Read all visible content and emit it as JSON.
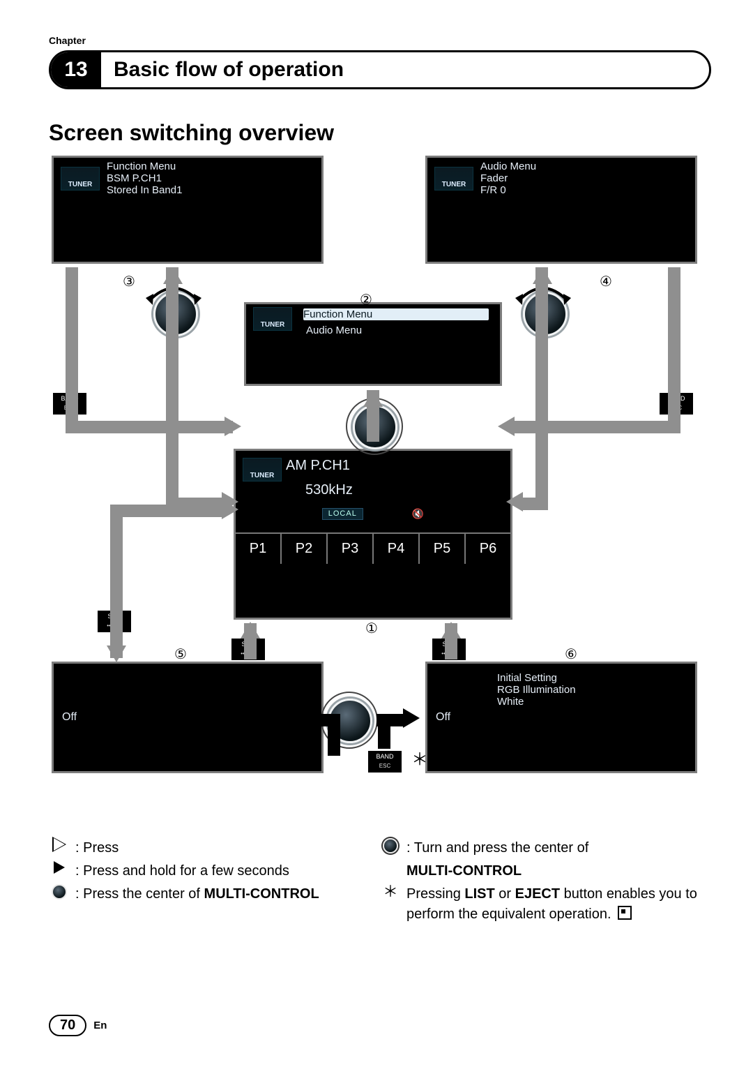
{
  "header": {
    "chapter_label": "Chapter",
    "number": "13",
    "title": "Basic flow of operation"
  },
  "h2": "Screen switching overview",
  "screens": {
    "top_left": {
      "badge": "TUNER",
      "lines": [
        "Function Menu",
        "BSM P.CH1",
        "Stored In Band1"
      ]
    },
    "top_right": {
      "badge": "TUNER",
      "lines": [
        "Audio Menu",
        "Fader",
        "F/R 0"
      ]
    },
    "middle_menu": {
      "badge": "TUNER",
      "highlight": "Function Menu",
      "line2": "Audio Menu"
    },
    "main": {
      "badge": "TUNER",
      "line1": "AM P.CH1",
      "freq": "530kHz",
      "local_tag": "LOCAL",
      "presets": [
        "P1",
        "P2",
        "P3",
        "P4",
        "P5",
        "P6"
      ]
    },
    "bottom_left": {
      "label": "Off"
    },
    "bottom_right": {
      "label": "Off",
      "lines": [
        "Initial Setting",
        "RGB Illumination",
        "White"
      ]
    }
  },
  "buttons": {
    "band": "BAND",
    "esc": "ESC",
    "src": "SRC",
    "off": "••OFF"
  },
  "call_nums": {
    "n1": "①",
    "n2": "②",
    "n3": "③",
    "n4": "④",
    "n5": "⑤",
    "n6": "⑥"
  },
  "star": "＊",
  "legend": {
    "press": ": Press",
    "press_hold": ": Press and hold for a few seconds",
    "press_center_prefix": ": Press the center of ",
    "multi_control": "MULTI-CONTROL",
    "turn_press": ": Turn and press the center of",
    "star_note_prefix": "Pressing ",
    "list": "LIST",
    "or": " or ",
    "eject": "EJECT",
    "star_note_suffix": " button enables you to perform the equivalent operation."
  },
  "footer": {
    "page": "70",
    "lang": "En"
  }
}
